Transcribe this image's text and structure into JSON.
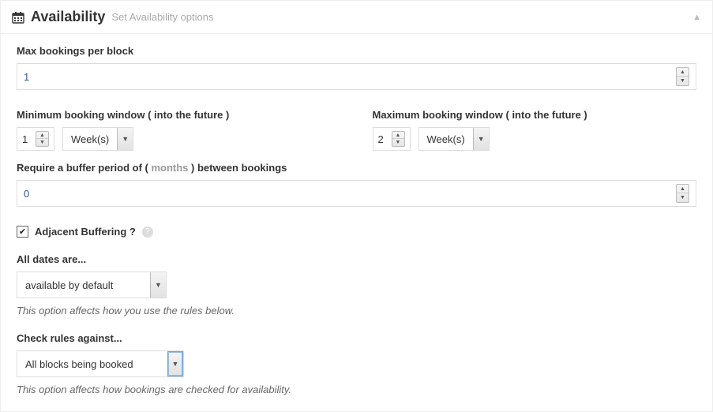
{
  "header": {
    "title": "Availability",
    "subtitle": "Set Availability options"
  },
  "max_bookings": {
    "label": "Max bookings per block",
    "value": "1"
  },
  "min_window": {
    "label": "Minimum booking window ( into the future )",
    "value": "1",
    "unit": "Week(s)"
  },
  "max_window": {
    "label": "Maximum booking window ( into the future )",
    "value": "2",
    "unit": "Week(s)"
  },
  "buffer": {
    "label_prefix": "Require a buffer period of ( ",
    "label_unit": "months",
    "label_suffix": " ) between bookings",
    "value": "0"
  },
  "adjacent": {
    "label": "Adjacent Buffering ?",
    "checked": true
  },
  "all_dates": {
    "label": "All dates are...",
    "value": "available by default",
    "help": "This option affects how you use the rules below."
  },
  "check_rules": {
    "label": "Check rules against...",
    "value": "All blocks being booked",
    "help": "This option affects how bookings are checked for availability."
  }
}
